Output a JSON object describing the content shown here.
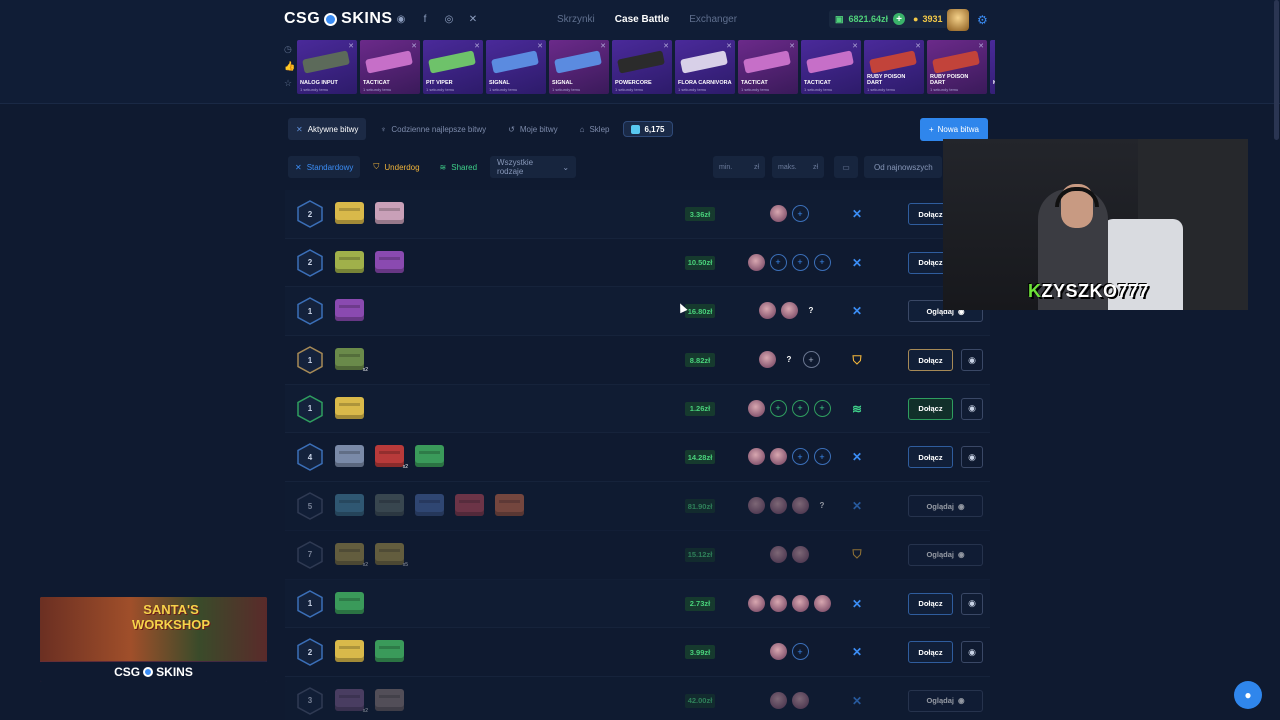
{
  "header": {
    "logo_left": "CSG",
    "logo_right": "SKINS",
    "nav": [
      "Skrzynki",
      "Case Battle",
      "Exchanger"
    ],
    "nav_active": "Case Battle",
    "balance": "6821.64zł",
    "coins": "3931"
  },
  "feed": [
    {
      "name": "NALOG INPUT",
      "sub": "1 sekundy temu",
      "color": "#5c6a5a"
    },
    {
      "name": "TACTICAT",
      "sub": "1 sekundy temu",
      "color": "#c66fc8"
    },
    {
      "name": "PIT VIPER",
      "sub": "1 sekundy temu",
      "color": "#6ec26a"
    },
    {
      "name": "SIGNAL",
      "sub": "1 sekundy temu",
      "color": "#5b8be0"
    },
    {
      "name": "SIGNAL",
      "sub": "1 sekundy temu",
      "color": "#5b8be0"
    },
    {
      "name": "POWERCORE",
      "sub": "1 sekundy temu",
      "color": "#2b2b2b"
    },
    {
      "name": "FLORA CARNIVORA",
      "sub": "1 sekundy temu",
      "color": "#d8d0e8"
    },
    {
      "name": "TACTICAT",
      "sub": "1 sekundy temu",
      "color": "#c66fc8"
    },
    {
      "name": "TACTICAT",
      "sub": "1 sekundy temu",
      "color": "#c66fc8"
    },
    {
      "name": "RUBY POISON DART",
      "sub": "1 sekundy temu",
      "color": "#c2433a"
    },
    {
      "name": "RUBY POISON DART",
      "sub": "1 sekundy temu",
      "color": "#c2433a"
    },
    {
      "name": "K",
      "sub": "",
      "color": "#c66fc8"
    }
  ],
  "tabs": {
    "active": "Aktywne bitwy",
    "daily": "Codzienne najlepsze bitwy",
    "mine": "Moje bitwy",
    "shop": "Sklep",
    "gems": "6,175",
    "new_battle": "Nowa bitwa"
  },
  "filters": {
    "standard": "Standardowy",
    "underdog": "Underdog",
    "shared": "Shared",
    "all_types": "Wszystkie rodzaje",
    "min": "min.",
    "max": "maks.",
    "currency": "zł",
    "sort": "Od najnowszych"
  },
  "buttons": {
    "join": "Dołącz",
    "watch": "Oglądaj"
  },
  "battles": [
    {
      "round": "2",
      "mode": "std",
      "price": "3.36zł",
      "cases": [
        "#d9b94a",
        "#c9a0b8"
      ],
      "players": [
        "av",
        "add"
      ],
      "action": "join",
      "dim": false
    },
    {
      "round": "2",
      "mode": "std",
      "price": "10.50zł",
      "cases": [
        "#a0b04a",
        "#8a4ab0"
      ],
      "players": [
        "av",
        "add",
        "add",
        "add"
      ],
      "action": "join",
      "dim": false
    },
    {
      "round": "1",
      "mode": "std",
      "price": "16.80zł",
      "cases": [
        "#8a4ab0"
      ],
      "players": [
        "av",
        "av",
        "q"
      ],
      "action": "watch",
      "dim": false
    },
    {
      "round": "1",
      "mode": "und",
      "price": "8.82zł",
      "cases": [
        "#6a8a4a"
      ],
      "players": [
        "av",
        "q",
        "add"
      ],
      "action": "join",
      "dim": false
    },
    {
      "round": "1",
      "mode": "sha",
      "price": "1.26zł",
      "cases": [
        "#d9b94a"
      ],
      "players": [
        "av",
        "add",
        "add",
        "add"
      ],
      "action": "join",
      "dim": false
    },
    {
      "round": "4",
      "mode": "std",
      "price": "14.28zł",
      "cases": [
        "#7a8aa8",
        "#b83a3a",
        "#3a9a5a"
      ],
      "players": [
        "av",
        "av",
        "add",
        "add"
      ],
      "action": "join",
      "dim": false
    },
    {
      "round": "5",
      "mode": "std",
      "price": "81.90zł",
      "cases": [
        "#4a8aa8",
        "#5a6a6a",
        "#4a6aa8",
        "#b84a5a",
        "#c86a4a"
      ],
      "players": [
        "av",
        "av",
        "av",
        "q"
      ],
      "action": "watch",
      "dim": true
    },
    {
      "round": "7",
      "mode": "und",
      "price": "15.12zł",
      "cases": [
        "#a8944a",
        "#a8944a"
      ],
      "players": [
        "av",
        "av"
      ],
      "action": "watch",
      "dim": true
    },
    {
      "round": "1",
      "mode": "std",
      "price": "2.73zł",
      "cases": [
        "#3a9a5a"
      ],
      "players": [
        "av",
        "av",
        "av",
        "av"
      ],
      "action": "join",
      "dim": false
    },
    {
      "round": "2",
      "mode": "std",
      "price": "3.99zł",
      "cases": [
        "#d9b94a",
        "#3a9a5a"
      ],
      "players": [
        "av",
        "add"
      ],
      "action": "join",
      "dim": false
    },
    {
      "round": "3",
      "mode": "std",
      "price": "42.00zł",
      "cases": [
        "#7a5a8a",
        "#8a7a7a"
      ],
      "players": [
        "av",
        "av"
      ],
      "action": "watch",
      "dim": true
    }
  ],
  "webcam": {
    "tag_first": "K",
    "tag_rest": "ZYSZKO777"
  },
  "promo": {
    "title": "SANTA'S WORKSHOP",
    "brand_left": "CSG",
    "brand_right": "SKINS"
  }
}
